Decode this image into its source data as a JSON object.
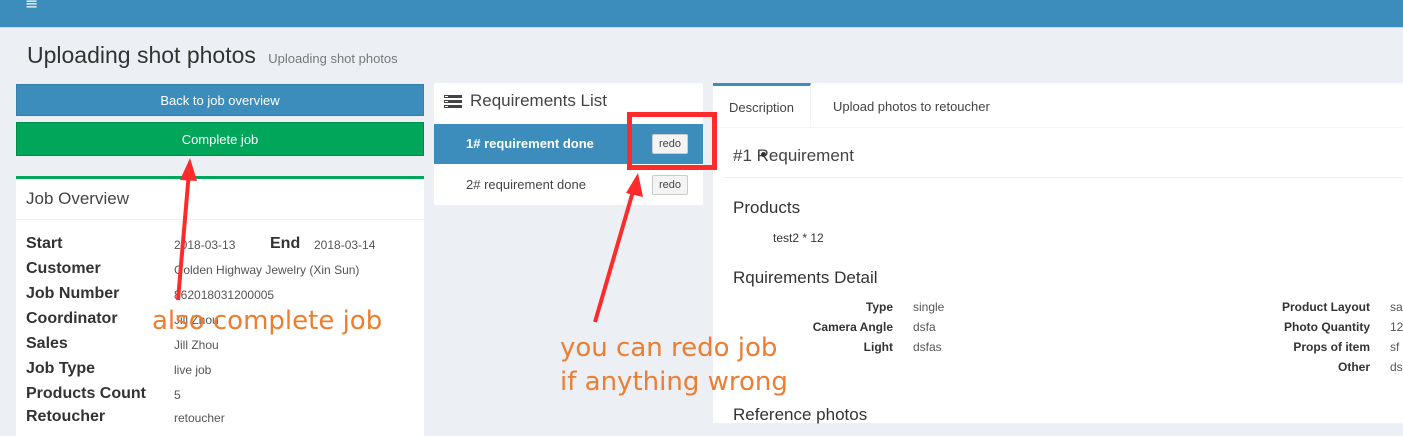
{
  "header": {
    "menu_icon": "hamburger-icon",
    "color": "#3c8dbc"
  },
  "page": {
    "title": "Uploading shot photos",
    "subtitle": "Uploading shot photos"
  },
  "actions": {
    "back_label": "Back to job overview",
    "complete_label": "Complete job"
  },
  "overview": {
    "title": "Job Overview",
    "start_label": "Start",
    "start": "2018-03-13",
    "end_label": "End",
    "end": "2018-03-14",
    "customer_label": "Customer",
    "customer": "Golden Highway Jewelry (Xin Sun)",
    "job_number_label": "Job Number",
    "job_number": "862018031200005",
    "coordinator_label": "Coordinator",
    "coordinator": "Jill Zhou",
    "sales_label": "Sales",
    "sales": "Jill Zhou",
    "job_type_label": "Job Type",
    "job_type": "live job",
    "products_count_label": "Products Count",
    "products_count": "5",
    "retoucher_label": "Retoucher",
    "retoucher": "retoucher"
  },
  "requirements": {
    "title": "Requirements List",
    "icon": "list-icon",
    "items": [
      {
        "label": "1# requirement done",
        "button": "redo"
      },
      {
        "label": "2# requirement done",
        "button": "redo"
      }
    ]
  },
  "detail": {
    "tabs": [
      "Description",
      "Upload photos to retoucher"
    ],
    "heading": "#1 Requirement",
    "products_heading": "Products",
    "products": [
      "test2 * 12"
    ],
    "detail_heading": "Rquirements Detail",
    "left": [
      {
        "label": "Type",
        "value": "single"
      },
      {
        "label": "Camera Angle",
        "value": "dsfa"
      },
      {
        "label": "Light",
        "value": "dsfas"
      }
    ],
    "right": [
      {
        "label": "Product Layout",
        "value": "sa"
      },
      {
        "label": "Photo Quantity",
        "value": "12"
      },
      {
        "label": "Props of item",
        "value": "sf"
      },
      {
        "label": "Other",
        "value": "ds"
      }
    ],
    "reference_heading": "Reference photos"
  },
  "annotations": {
    "complete_note": "also complete job",
    "redo_note_line1": "you can redo job",
    "redo_note_line2": "if anything wrong",
    "note_color": "#ed7d31",
    "arrow_color": "#ff2a2a"
  }
}
